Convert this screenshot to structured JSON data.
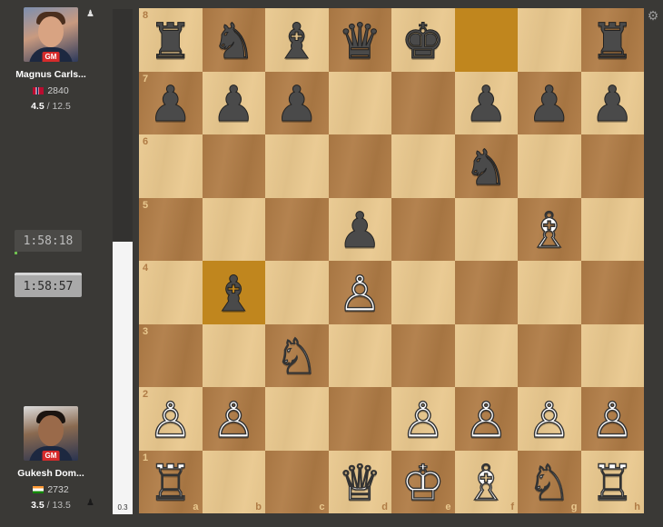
{
  "players": {
    "top": {
      "name": "Magnus Carls...",
      "title": "GM",
      "flag": "NO",
      "rating": "2840",
      "score_points": "4.5",
      "score_rest": " / 12.5",
      "clock": "1:58:18"
    },
    "bottom": {
      "name": "Gukesh Dom...",
      "title": "GM",
      "flag": "IN",
      "rating": "2732",
      "score_points": "3.5",
      "score_rest": " / 13.5",
      "clock": "1:58:57"
    }
  },
  "eval": {
    "label": "0.3",
    "white_fraction": 0.54
  },
  "board": {
    "files": [
      "a",
      "b",
      "c",
      "d",
      "e",
      "f",
      "g",
      "h"
    ],
    "ranks": [
      "8",
      "7",
      "6",
      "5",
      "4",
      "3",
      "2",
      "1"
    ],
    "highlight_squares": [
      "f8",
      "b4"
    ],
    "rows": [
      [
        "b:rook",
        "b:knight",
        "b:bishop",
        "b:queen",
        "b:king",
        "",
        "",
        "b:rook"
      ],
      [
        "b:pawn",
        "b:pawn",
        "b:pawn",
        "",
        "",
        "b:pawn",
        "b:pawn",
        "b:pawn"
      ],
      [
        "",
        "",
        "",
        "",
        "",
        "b:knight",
        "",
        ""
      ],
      [
        "",
        "",
        "",
        "b:pawn",
        "",
        "",
        "w:bishop",
        ""
      ],
      [
        "",
        "b:bishop",
        "",
        "w:pawn",
        "",
        "",
        "",
        ""
      ],
      [
        "",
        "",
        "w:knight",
        "",
        "",
        "",
        "",
        ""
      ],
      [
        "w:pawn",
        "w:pawn",
        "",
        "",
        "w:pawn",
        "w:pawn",
        "w:pawn",
        "w:pawn"
      ],
      [
        "w:rook",
        "",
        "",
        "w:queen",
        "w:king",
        "w:bishop",
        "w:knight",
        "w:rook"
      ]
    ]
  },
  "icons": {
    "settings": "gear-icon",
    "person": "person-icon"
  },
  "colors": {
    "light_square": "#e9c88e",
    "dark_square": "#b07c46",
    "highlight": "#c0861e",
    "background": "#3a3936"
  }
}
